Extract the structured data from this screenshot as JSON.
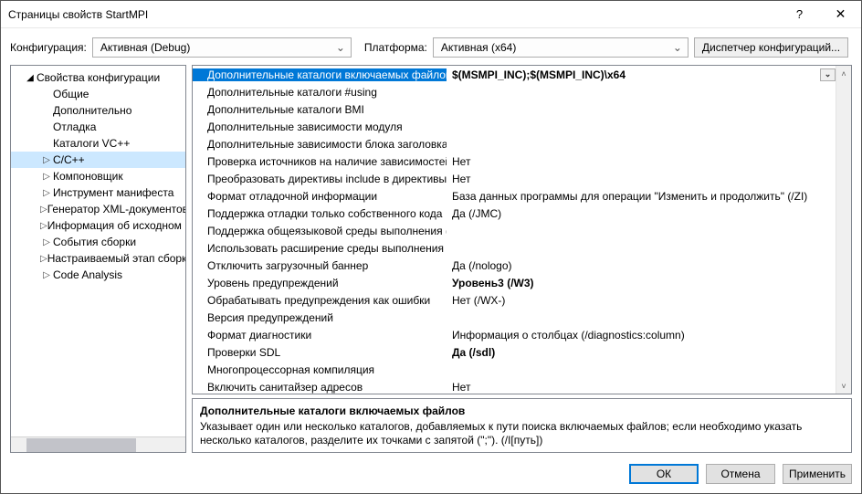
{
  "window_title": "Страницы свойств StartMPI",
  "ctrl_help": "?",
  "ctrl_close": "✕",
  "labels": {
    "configuration": "Конфигурация:",
    "platform": "Платформа:"
  },
  "combos": {
    "configuration": "Активная (Debug)",
    "platform": "Активная (x64)"
  },
  "buttons": {
    "config_manager": "Диспетчер конфигураций...",
    "ok": "ОК",
    "cancel": "Отмена",
    "apply": "Применить"
  },
  "tree": {
    "root": "Свойства конфигурации",
    "items": [
      "Общие",
      "Дополнительно",
      "Отладка",
      "Каталоги VC++",
      "C/C++",
      "Компоновщик",
      "Инструмент манифеста",
      "Генератор XML-документов",
      "Информация об исходном коде",
      "События сборки",
      "Настраиваемый этап сборки",
      "Code Analysis"
    ]
  },
  "props": [
    {
      "name": "Дополнительные каталоги включаемых файлов",
      "value": "$(MSMPI_INC);$(MSMPI_INC)\\x64",
      "sel": true,
      "bold": true
    },
    {
      "name": "Дополнительные каталоги #using",
      "value": ""
    },
    {
      "name": "Дополнительные каталоги BMI",
      "value": ""
    },
    {
      "name": "Дополнительные зависимости модуля",
      "value": ""
    },
    {
      "name": "Дополнительные зависимости блока заголовка",
      "value": ""
    },
    {
      "name": "Проверка источников на наличие зависимостей модулей",
      "value": "Нет"
    },
    {
      "name": "Преобразовать директивы include в директивы импорта",
      "value": "Нет"
    },
    {
      "name": "Формат отладочной информации",
      "value": "База данных программы для операции \"Изменить и продолжить\" (/ZI)"
    },
    {
      "name": "Поддержка отладки только собственного кода",
      "value": "Да (/JMC)"
    },
    {
      "name": "Поддержка общеязыковой среды выполнения (CLR)",
      "value": ""
    },
    {
      "name": "Использовать расширение среды выполнения Windows",
      "value": ""
    },
    {
      "name": "Отключить загрузочный баннер",
      "value": "Да (/nologo)"
    },
    {
      "name": "Уровень предупреждений",
      "value": "Уровень3 (/W3)",
      "bold": true
    },
    {
      "name": "Обрабатывать предупреждения как ошибки",
      "value": "Нет (/WX-)"
    },
    {
      "name": "Версия предупреждений",
      "value": ""
    },
    {
      "name": "Формат диагностики",
      "value": "Информация о столбцах (/diagnostics:column)"
    },
    {
      "name": "Проверки SDL",
      "value": "Да (/sdl)",
      "bold": true
    },
    {
      "name": "Многопроцессорная компиляция",
      "value": ""
    },
    {
      "name": "Включить санитайзер адресов",
      "value": "Нет"
    }
  ],
  "desc": {
    "title": "Дополнительные каталоги включаемых файлов",
    "body": "Указывает один или несколько каталогов, добавляемых к пути поиска включаемых файлов; если необходимо указать несколько каталогов, разделите их точками с запятой (\";\").     (/I[путь])"
  }
}
